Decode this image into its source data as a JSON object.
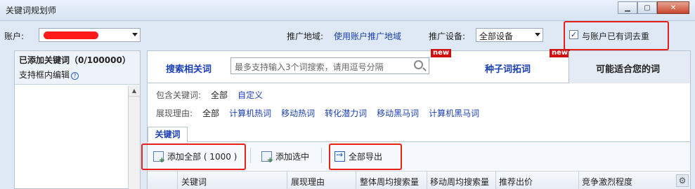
{
  "window": {
    "title": "关键词规划师"
  },
  "top": {
    "account_label": "账户:",
    "region_label": "推广地域:",
    "region_value": "使用账户推广地域",
    "device_label": "推广设备:",
    "device_value": "全部设备",
    "dedupe_label": "与账户已有词去重",
    "dedupe_checked": true
  },
  "left": {
    "added_title": "已添加关键词（0/100000）",
    "edit_hint": "支持框内编辑"
  },
  "tabs": {
    "search_related": "搜索相关词",
    "search_placeholder": "最多支持输入3个词搜索，请用逗号分隔",
    "seed_expand": "种子词拓词",
    "may_suit": "可能适合您的词",
    "new_badge": "new"
  },
  "filters": {
    "contains_label": "包含关键词:",
    "contains_options": [
      "全部",
      "自定义"
    ],
    "reason_label": "展现理由:",
    "reason_options": [
      "全部",
      "计算机热词",
      "移动热词",
      "转化潜力词",
      "移动黑马词",
      "计算机黑马词"
    ]
  },
  "keyword_tab": "关键词",
  "toolbar": {
    "add_all": "添加全部 ( 1000 )",
    "add_selected": "添加选中",
    "export_all": "全部导出"
  },
  "table": {
    "columns": [
      "关键词",
      "展现理由",
      "整体周均搜索量",
      "移动周均搜索量",
      "推荐出价",
      "竞争激烈程度"
    ]
  },
  "colors": {
    "link": "#1a3fb0",
    "highlight": "#e8201a",
    "new_badge": "#d01010"
  }
}
